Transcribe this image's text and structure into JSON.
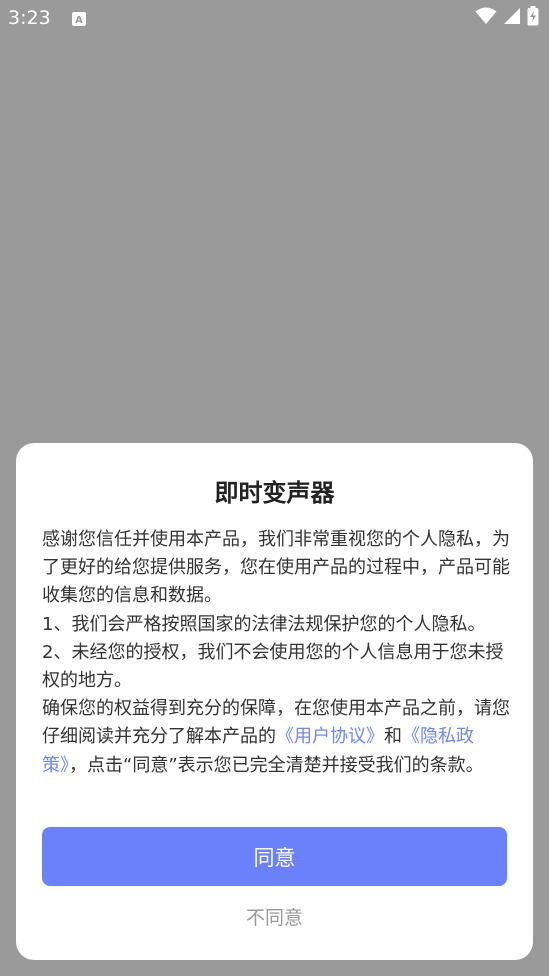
{
  "status_bar": {
    "time": "3:23",
    "icons": [
      "notification-a-icon",
      "wifi-icon",
      "signal-icon",
      "battery-charging-icon"
    ]
  },
  "dialog": {
    "title": "即时变声器",
    "intro": "感谢您信任并使用本产品，我们非常重视您的个人隐私，为了更好的给您提供服务，您在使用产品的过程中，产品可能收集您的信息和数据。",
    "point1": "1、我们会严格按照国家的法律法规保护您的个人隐私。",
    "point2": "2、未经您的授权，我们不会使用您的个人信息用于您未授权的地方。",
    "closing_prefix": "确保您的权益得到充分的保障，在您使用本产品之前，请您仔细阅读并充分了解本产品的",
    "user_agreement_link": "《用户协议》",
    "and": "和",
    "privacy_policy_link": "《隐私政策》",
    "closing_suffix": "，点击“同意”表示您已完全清楚并接受我们的条款。",
    "agree_label": "同意",
    "disagree_label": "不同意"
  },
  "colors": {
    "overlay": "#9a9a9a",
    "accent": "#6b81fb",
    "link": "#6d87f5",
    "secondary_text": "#9a9a9a"
  }
}
